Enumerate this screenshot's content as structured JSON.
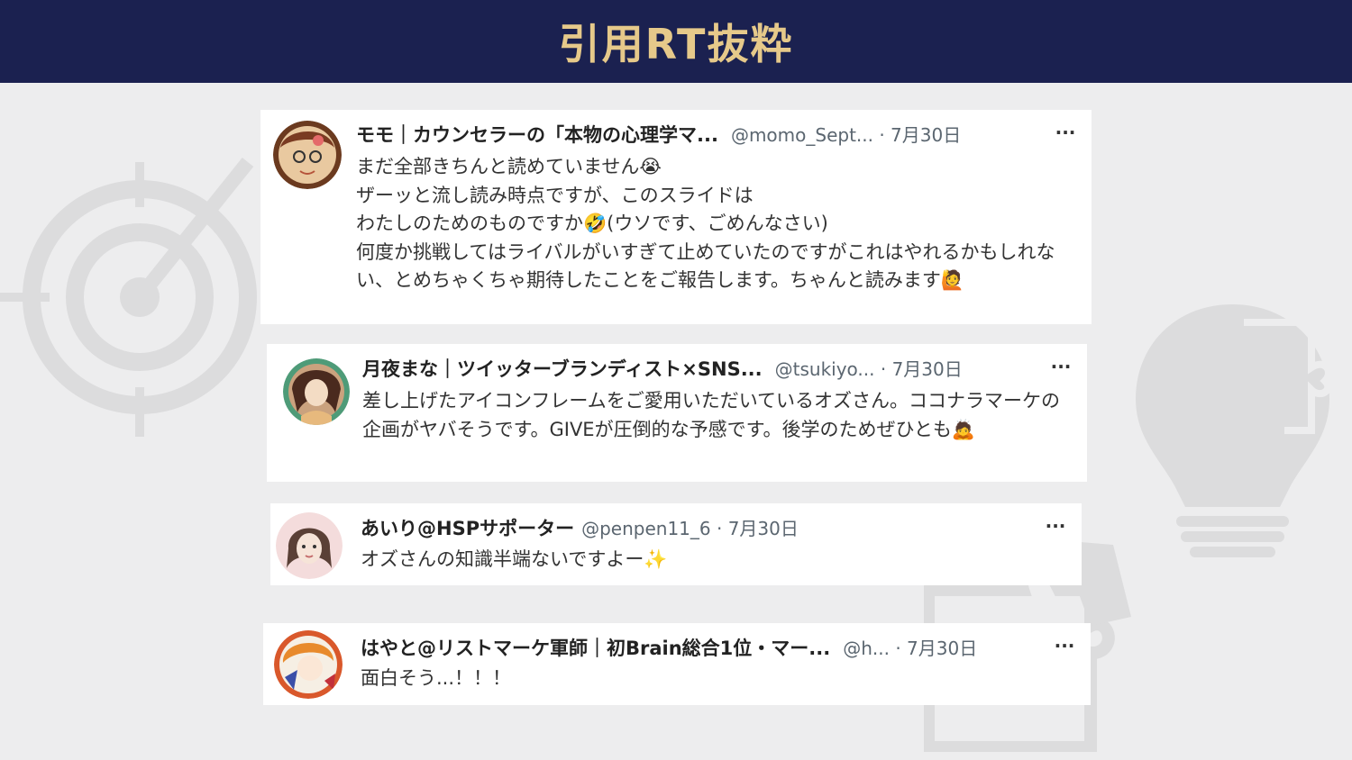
{
  "header": {
    "title": "引用RT抜粋"
  },
  "tweets": [
    {
      "name": "モモ｜カウンセラーの「本物の心理学マ...",
      "handle_date": "@momo_Sept... · 7月30日",
      "text": "まだ全部きちんと読めていません😭\nザーッと流し読み時点ですが、このスライドは\nわたしのためのものですか🤣(ウソです、ごめんなさい)\n何度か挑戦してはライバルがいすぎて止めていたのですがこれはやれるかもしれない、とめちゃくちゃ期待したことをご報告します。ちゃんと読みます🙋",
      "more": "···"
    },
    {
      "name": "月夜まな｜ツイッターブランディスト×SNS...",
      "handle_date": "@tsukiyo... · 7月30日",
      "text": "差し上げたアイコンフレームをご愛用いただいているオズさん。ココナラマーケの企画がヤバそうです。GIVEが圧倒的な予感です。後学のためぜひとも🙇",
      "more": "···"
    },
    {
      "name": "あいり@HSPサポーター",
      "handle_date": "@penpen11_6 · 7月30日",
      "text": "オズさんの知識半端ないですよー✨",
      "more": "···"
    },
    {
      "name": "はやと@リストマーケ軍師｜初Brain総合1位・マー...",
      "handle_date": "@h... · 7月30日",
      "text": "面白そう...！！！",
      "more": "···"
    }
  ],
  "background_icons": [
    "target-icon",
    "lightbulb-icon",
    "puzzle-icon"
  ],
  "colors": {
    "header_bg": "#1b2150",
    "header_text": "#e6c98a",
    "page_bg": "#ededee"
  }
}
